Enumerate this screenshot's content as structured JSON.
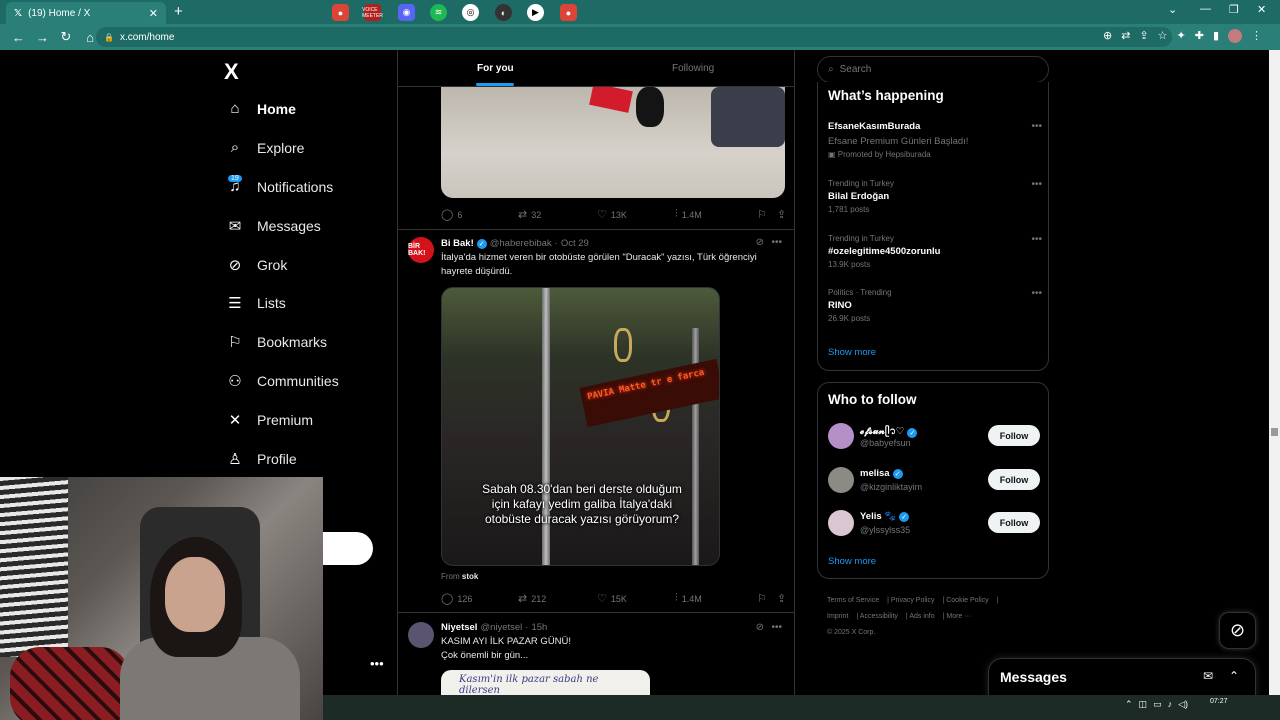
{
  "browser": {
    "tab_title": "(19) Home / X",
    "tab_icon": "x-logo-icon",
    "url": "x.com/home"
  },
  "nav": {
    "logo": "X",
    "notifications_badge": "19",
    "items": [
      {
        "label": "Home",
        "icon": "home-icon"
      },
      {
        "label": "Explore",
        "icon": "search-icon"
      },
      {
        "label": "Notifications",
        "icon": "bell-icon"
      },
      {
        "label": "Messages",
        "icon": "envelope-icon"
      },
      {
        "label": "Grok",
        "icon": "grok-icon"
      },
      {
        "label": "Lists",
        "icon": "list-icon"
      },
      {
        "label": "Bookmarks",
        "icon": "bookmark-icon"
      },
      {
        "label": "Communities",
        "icon": "people-icon"
      },
      {
        "label": "Premium",
        "icon": "x-icon"
      },
      {
        "label": "Profile",
        "icon": "person-icon"
      }
    ]
  },
  "feed_tabs": {
    "for_you": "For you",
    "following": "Following"
  },
  "tweet1": {
    "replies": "6",
    "reposts": "32",
    "likes": "13K",
    "views": "1.4M"
  },
  "tweet2": {
    "name": "Bi Bak!",
    "avatar_text": "BİR BAK!",
    "handle": "@haberebibak",
    "date": "Oct 29",
    "text": "İtalya'da hizmet veren bir otobüste görülen \"Duracak\" yazısı, Türk öğrenciyi hayrete düşürdü.",
    "video_led": "PAVIA Matte tr e farca",
    "video_caption": "Sabah 08.30'dan beri derste olduğum için kafayı yedim galiba İtalya'daki otobüste duracak yazısı görüyorum?",
    "from_label": "From",
    "from_source": "stok",
    "replies": "126",
    "reposts": "212",
    "likes": "15K",
    "views": "1.4M"
  },
  "tweet3": {
    "name": "Niyetsel",
    "handle": "@niyetsel",
    "date": "15h",
    "line1": "KASIM AYI İLK PAZAR GÜNÜ!",
    "line2": "Çok önemli bir gün...",
    "image_text": "Kasım'in ilk pazar sabah ne dilersen"
  },
  "search": {
    "placeholder": "Search"
  },
  "trends": {
    "title": "What’s happening",
    "items": [
      {
        "meta": "",
        "name": "EfsaneKasımBurada",
        "desc": "Efsane Premium Günleri Başladı!",
        "sub": "Promoted by Hepsiburada"
      },
      {
        "meta": "Trending in Turkey",
        "name": "Bilal Erdoğan",
        "sub": "1,781 posts"
      },
      {
        "meta": "Trending in Turkey",
        "name": "#ozelegitime4500zorunlu",
        "sub": "13.9K posts"
      },
      {
        "meta": "Politics · Trending",
        "name": "RINO",
        "sub": "26.9K posts"
      }
    ],
    "show_more": "Show more"
  },
  "who_to_follow": {
    "title": "Who to follow",
    "users": [
      {
        "name": "𝓮𝓯𝓼𝓾𝓷ᥫ᭡♡",
        "handle": "@babyefsun",
        "button": "Follow"
      },
      {
        "name": "melisa",
        "handle": "@kizginliktayim",
        "button": "Follow"
      },
      {
        "name": "Yelis 🐾",
        "handle": "@ylssylss35",
        "button": "Follow"
      }
    ],
    "show_more": "Show more"
  },
  "footer": {
    "links": [
      "Terms of Service",
      "Privacy Policy",
      "Cookie Policy",
      "Imprint",
      "Accessibility",
      "Ads info",
      "More ···"
    ],
    "copyright": "© 2025 X Corp."
  },
  "messages_drawer": {
    "title": "Messages"
  },
  "taskbar": {
    "time": "07:27",
    "stream_label": "VOICE MEETER"
  },
  "colors": {
    "accent": "#1d9bf0",
    "chrome": "#2a7f79",
    "bg": "#000000"
  }
}
